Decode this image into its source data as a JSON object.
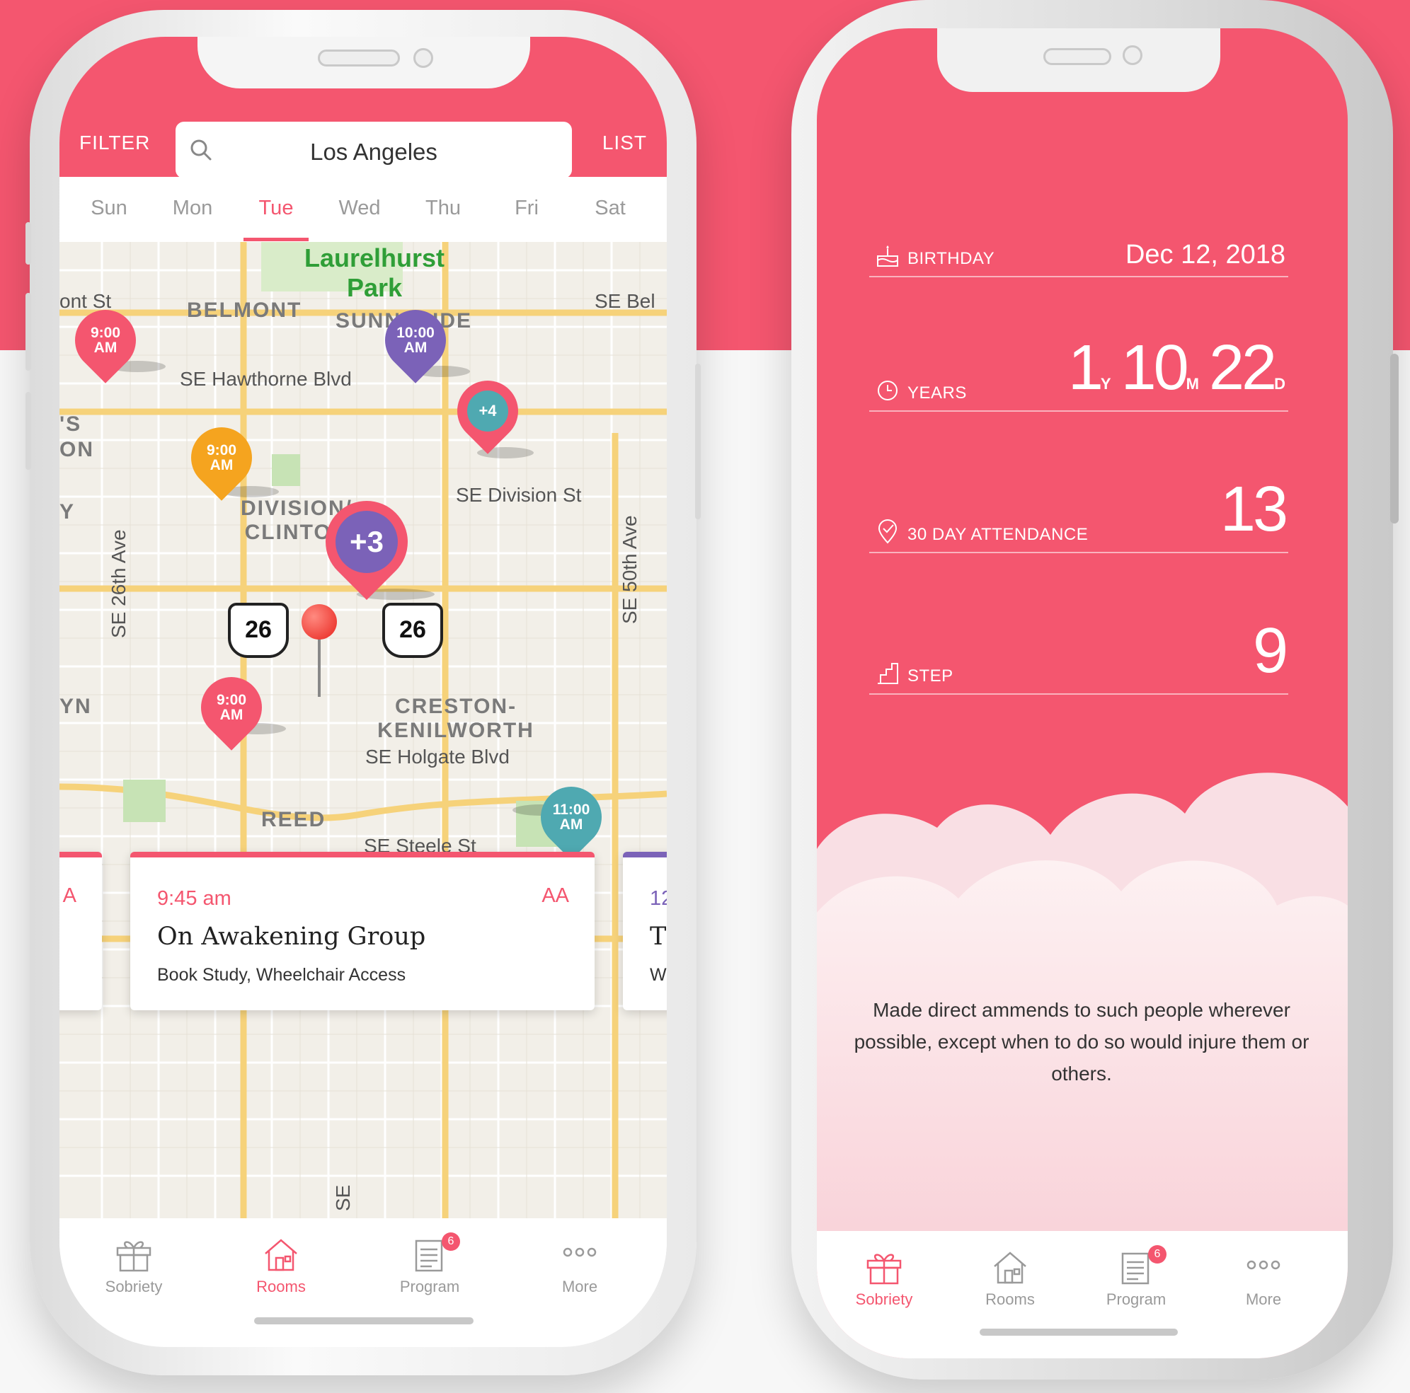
{
  "brand_color": "#f4566f",
  "meetings_screen": {
    "header": {
      "filter_label": "FILTER",
      "list_label": "LIST",
      "search_value": "Los Angeles"
    },
    "days": [
      "Sun",
      "Mon",
      "Tue",
      "Wed",
      "Thu",
      "Fri",
      "Sat"
    ],
    "active_day": "Tue",
    "map": {
      "park_label": "Laurelhurst Park",
      "neighborhoods": [
        "BELMONT",
        "SUNNYSIDE",
        "DIVISION/ CLINTON",
        "CRESTON- KENILWORTH",
        "REED",
        "'S ON",
        "Y",
        "YN"
      ],
      "streets": [
        "SE Hawthorne Blvd",
        "SE Division St",
        "SE Holgate Blvd",
        "SE 26th Ave",
        "SE 50th Ave",
        "ont St",
        "SE Bel",
        "SE Steele St",
        "SE"
      ],
      "route_shields": [
        "26",
        "26"
      ],
      "pins": [
        {
          "label": "9:00 AM",
          "color": "#f4566f"
        },
        {
          "label": "10:00 AM",
          "color": "#7b62b8"
        },
        {
          "label": "+4",
          "color": "#4fa9b1"
        },
        {
          "label": "9:00 AM",
          "color": "#f5a41f"
        },
        {
          "label": "+3",
          "color": "#7b62b8"
        },
        {
          "label": "9:00 AM",
          "color": "#f4566f"
        },
        {
          "label": "11:00 AM",
          "color": "#4fa9b1"
        }
      ]
    },
    "cards": [
      {
        "time": "",
        "badge": "A",
        "name": "",
        "tags": ""
      },
      {
        "time": "9:45 am",
        "badge": "AA",
        "name": "On Awakening Group",
        "tags": "Book Study, Wheelchair Access"
      },
      {
        "time": "12",
        "badge": "",
        "name": "Ti",
        "tags": "W"
      }
    ],
    "tabs": [
      {
        "label": "Sobriety",
        "icon": "gift-icon"
      },
      {
        "label": "Rooms",
        "icon": "house-icon",
        "active": true
      },
      {
        "label": "Program",
        "icon": "document-icon",
        "badge": "6"
      },
      {
        "label": "More",
        "icon": "more-dots-icon"
      }
    ]
  },
  "sobriety_screen": {
    "stats": {
      "birthday": {
        "label": "BIRTHDAY",
        "value": "Dec 12, 2018"
      },
      "years": {
        "label": "YEARS",
        "y": "1",
        "y_unit": "Y",
        "m": "10",
        "m_unit": "M",
        "d": "22",
        "d_unit": "D"
      },
      "attendance": {
        "label": "30 DAY ATTENDANCE",
        "value": "13"
      },
      "step": {
        "label": "STEP",
        "value": "9"
      }
    },
    "quote": "Made direct ammends to such people wherever possible, except when to do so would injure them or others.",
    "tabs": [
      {
        "label": "Sobriety",
        "icon": "gift-icon",
        "active": true
      },
      {
        "label": "Rooms",
        "icon": "house-icon"
      },
      {
        "label": "Program",
        "icon": "document-icon",
        "badge": "6"
      },
      {
        "label": "More",
        "icon": "more-dots-icon"
      }
    ]
  }
}
